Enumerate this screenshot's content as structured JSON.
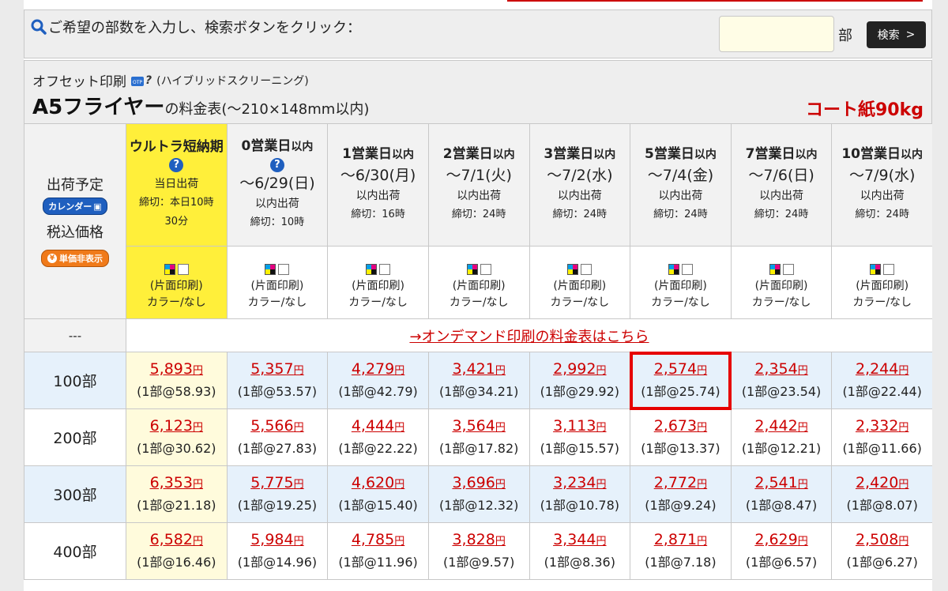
{
  "search": {
    "label": "ご希望の部数を入力し、検索ボタンをクリック：",
    "input_value": "",
    "unit": "部",
    "button": "検索",
    "button_arrow": ">"
  },
  "header": {
    "method": "オフセット印刷",
    "otp_badge": "OTP",
    "help_mark": "?",
    "screening": "(ハイブリッドスクリーニング)",
    "product": "A5フライヤー",
    "table_suffix": "の料金表(〜210×148mm以内)",
    "paper": "コート紙90kg"
  },
  "labels": {
    "ship": "出荷予定",
    "calendar": "カレンダー",
    "tax": "税込価格",
    "unit_hide": "単価非表示",
    "yen": "¥",
    "od_dash": "---",
    "od_link": "→オンデマンド印刷の料金表はこちら",
    "q_mark": "?"
  },
  "columns": [
    {
      "title": "ウルトラ短納期",
      "date": "当日出荷",
      "note": "締切：本日10時",
      "cut": "30分",
      "ink": "(片面印刷)",
      "color": "カラー/なし"
    },
    {
      "title": "0営業日",
      "suffix": "以内",
      "date": "〜6/29(日)",
      "note": "以内出荷",
      "cut": "締切：10時",
      "ink": "(片面印刷)",
      "color": "カラー/なし"
    },
    {
      "title": "1営業日",
      "suffix": "以内",
      "date": "〜6/30(月)",
      "note": "以内出荷",
      "cut": "締切：16時",
      "ink": "(片面印刷)",
      "color": "カラー/なし"
    },
    {
      "title": "2営業日",
      "suffix": "以内",
      "date": "〜7/1(火)",
      "note": "以内出荷",
      "cut": "締切：24時",
      "ink": "(片面印刷)",
      "color": "カラー/なし"
    },
    {
      "title": "3営業日",
      "suffix": "以内",
      "date": "〜7/2(水)",
      "note": "以内出荷",
      "cut": "締切：24時",
      "ink": "(片面印刷)",
      "color": "カラー/なし"
    },
    {
      "title": "5営業日",
      "suffix": "以内",
      "date": "〜7/4(金)",
      "note": "以内出荷",
      "cut": "締切：24時",
      "ink": "(片面印刷)",
      "color": "カラー/なし"
    },
    {
      "title": "7営業日",
      "suffix": "以内",
      "date": "〜7/6(日)",
      "note": "以内出荷",
      "cut": "締切：24時",
      "ink": "(片面印刷)",
      "color": "カラー/なし"
    },
    {
      "title": "10営業日",
      "suffix": "以内",
      "date": "〜7/9(水)",
      "note": "以内出荷",
      "cut": "締切：24時",
      "ink": "(片面印刷)",
      "color": "カラー/なし"
    }
  ],
  "yen_suffix": "円",
  "rows": [
    {
      "qty": "100部",
      "prices": [
        "5,893",
        "5,357",
        "4,279",
        "3,421",
        "2,992",
        "2,574",
        "2,354",
        "2,244"
      ],
      "units": [
        "(1部@58.93)",
        "(1部@53.57)",
        "(1部@42.79)",
        "(1部@34.21)",
        "(1部@29.92)",
        "(1部@25.74)",
        "(1部@23.54)",
        "(1部@22.44)"
      ]
    },
    {
      "qty": "200部",
      "prices": [
        "6,123",
        "5,566",
        "4,444",
        "3,564",
        "3,113",
        "2,673",
        "2,442",
        "2,332"
      ],
      "units": [
        "(1部@30.62)",
        "(1部@27.83)",
        "(1部@22.22)",
        "(1部@17.82)",
        "(1部@15.57)",
        "(1部@13.37)",
        "(1部@12.21)",
        "(1部@11.66)"
      ]
    },
    {
      "qty": "300部",
      "prices": [
        "6,353",
        "5,775",
        "4,620",
        "3,696",
        "3,234",
        "2,772",
        "2,541",
        "2,420"
      ],
      "units": [
        "(1部@21.18)",
        "(1部@19.25)",
        "(1部@15.40)",
        "(1部@12.32)",
        "(1部@10.78)",
        "(1部@9.24)",
        "(1部@8.47)",
        "(1部@8.07)"
      ]
    },
    {
      "qty": "400部",
      "prices": [
        "6,582",
        "5,984",
        "4,785",
        "3,828",
        "3,344",
        "2,871",
        "2,629",
        "2,508"
      ],
      "units": [
        "(1部@16.46)",
        "(1部@14.96)",
        "(1部@11.96)",
        "(1部@9.57)",
        "(1部@8.36)",
        "(1部@7.18)",
        "(1部@6.57)",
        "(1部@6.27)"
      ]
    }
  ],
  "highlight": {
    "row": 0,
    "col": 5
  },
  "colors": {
    "accent_red": "#cc0000",
    "yellow": "#ffef3a",
    "row_blue": "#e6f1fb",
    "button_blue": "#1f5fbf"
  }
}
